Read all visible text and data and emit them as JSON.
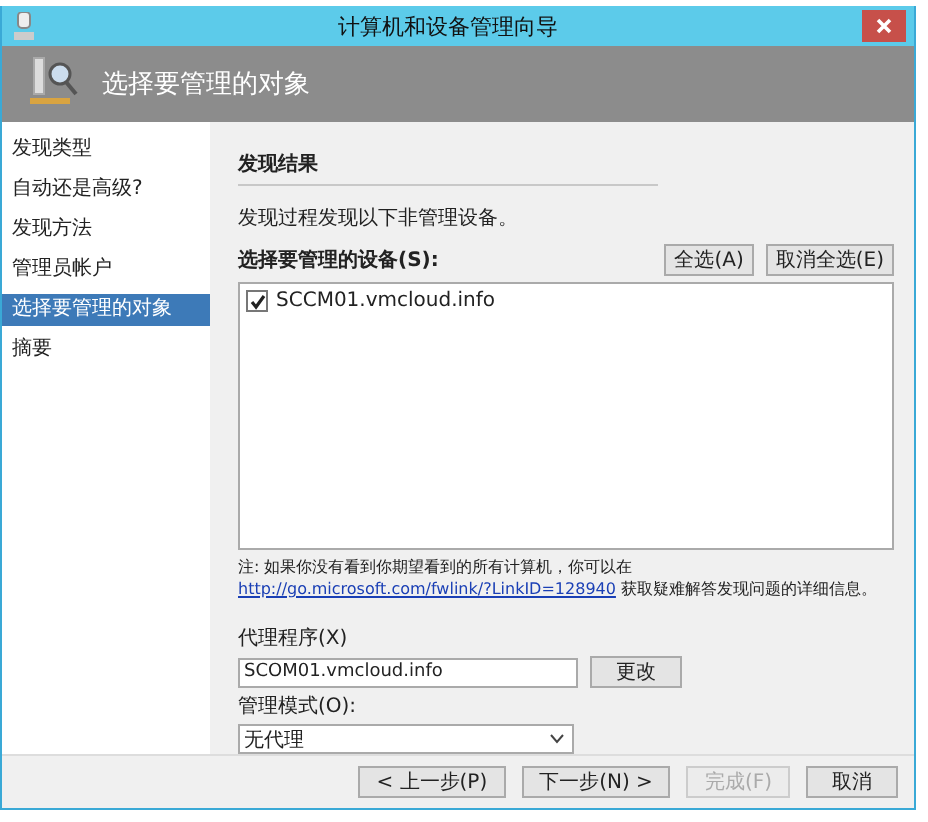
{
  "window": {
    "title": "计算机和设备管理向导"
  },
  "header": {
    "title": "选择要管理的对象"
  },
  "sidebar": {
    "items": [
      {
        "label": "发现类型",
        "selected": false
      },
      {
        "label": "自动还是高级?",
        "selected": false
      },
      {
        "label": "发现方法",
        "selected": false
      },
      {
        "label": "管理员帐户",
        "selected": false
      },
      {
        "label": "选择要管理的对象",
        "selected": true
      },
      {
        "label": "摘要",
        "selected": false
      }
    ]
  },
  "content": {
    "section_title": "发现结果",
    "description": "发现过程发现以下非管理设备。",
    "devices_label": "选择要管理的设备(S):",
    "select_buttons": [
      "全选(A)",
      "取消全选(E)"
    ],
    "devices": [
      {
        "name": "SCCM01.vmcloud.info",
        "checked": true
      }
    ],
    "note": "注: 如果你没有看到你期望看到的所有计算机，你可以在",
    "link": "http://go.microsoft.com/fwlink/?LinkID=128940",
    "link_suffix": "获取疑难解答发现问题的详细信息。",
    "agent_label": "代理程序(X)",
    "agent_value": "SCOM01.vmcloud.info",
    "change_button": "更改",
    "mode_label": "管理模式(O):",
    "mode_value": "无代理"
  },
  "footer": {
    "buttons": [
      {
        "label": "< 上一步(P)",
        "disabled": false
      },
      {
        "label": "下一步(N) >",
        "disabled": false
      },
      {
        "label": "完成(F)",
        "disabled": true
      },
      {
        "label": "取消",
        "disabled": false
      }
    ]
  }
}
